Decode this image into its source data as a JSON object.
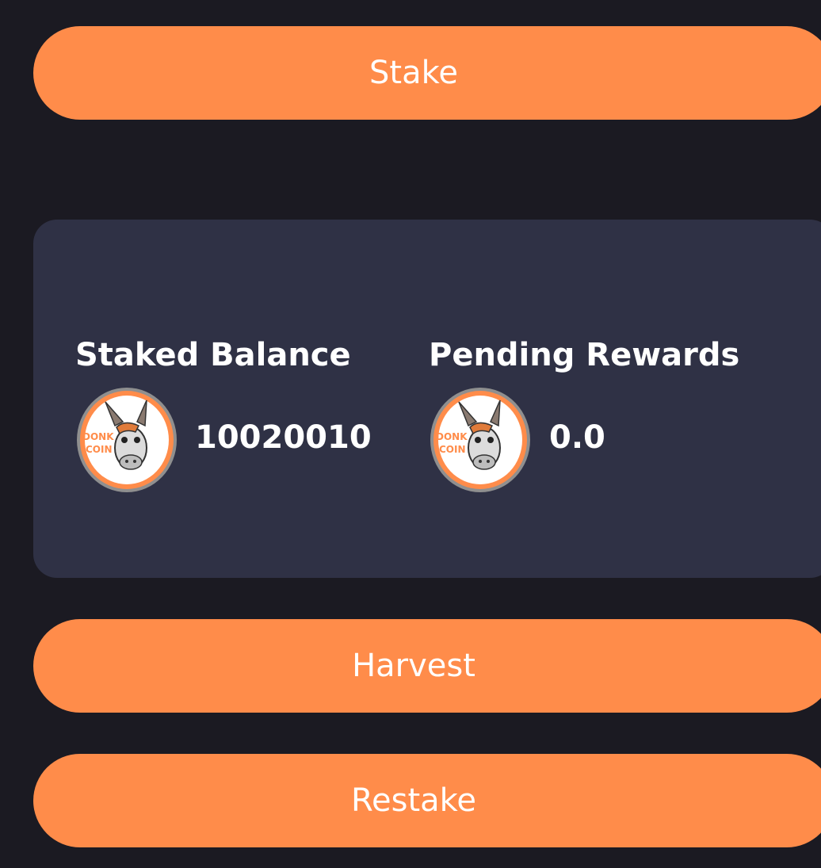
{
  "buttons": {
    "stake_label": "Stake",
    "harvest_label": "Harvest",
    "restake_label": "Restake"
  },
  "staked": {
    "title": "Staked Balance",
    "value": "10020010"
  },
  "pending": {
    "title": "Pending Rewards",
    "value": "0.0"
  },
  "coin": {
    "logo_text_line1": "DONK",
    "logo_text_line2": "COIN",
    "icon": "donk-coin-logo-icon"
  },
  "colors": {
    "background": "#1b1a22",
    "card": "#2f3145",
    "accent": "#ff8c4a",
    "text": "#ffffff"
  }
}
